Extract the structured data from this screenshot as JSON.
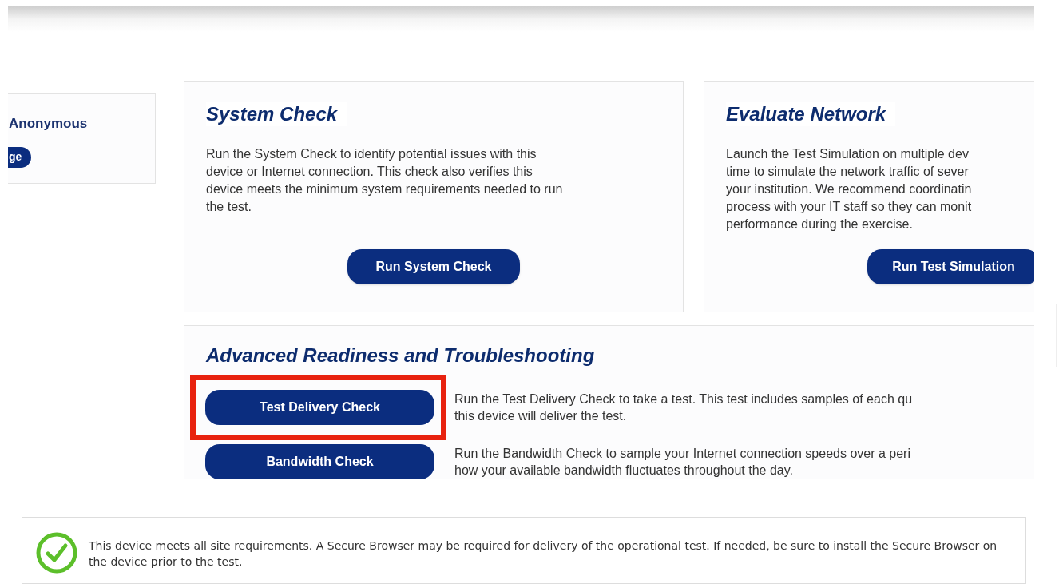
{
  "user_panel": {
    "name": "Anonymous",
    "button": "ge"
  },
  "cards": [
    {
      "title": "System Check",
      "lines": [
        "Run the System Check to identify potential issues with this",
        "device or Internet connection. This check also verifies this",
        "device meets the minimum system requirements needed to run",
        "the test."
      ],
      "button": "Run System Check"
    },
    {
      "title": "Evaluate Network",
      "lines": [
        "Launch the Test Simulation on multiple dev",
        "time to simulate the network traffic of sever",
        "your institution. We recommend coordinatin",
        "process with your IT staff so they can monit",
        "performance during the exercise."
      ],
      "button": "Run Test Simulation"
    }
  ],
  "advanced": {
    "title": "Advanced Readiness and Troubleshooting",
    "rows": [
      {
        "button": "Test Delivery Check",
        "highlighted": true,
        "lines": [
          "Run the Test Delivery Check to take a test. This test includes samples of each qu",
          "this device will deliver the test."
        ]
      },
      {
        "button": "Bandwidth Check",
        "highlighted": false,
        "lines": [
          "Run the Bandwidth Check to sample your Internet connection speeds over a peri",
          "how your available bandwidth fluctuates throughout the day."
        ]
      }
    ]
  },
  "status": {
    "ok": true,
    "message": "This device meets all site requirements. A Secure Browser may be required for delivery of the operational test. If needed, be sure to install the Secure Browser on the device prior to the test."
  }
}
